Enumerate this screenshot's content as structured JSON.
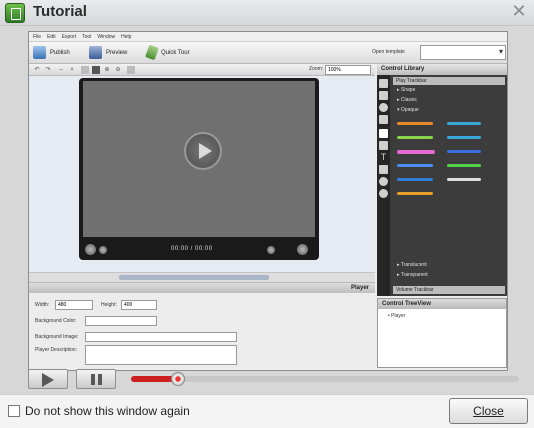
{
  "dialog": {
    "title": "Tutorial",
    "close_glyph": "✕",
    "dont_show_label": "Do not show this window again",
    "dont_show_checked": false,
    "close_label": "Close"
  },
  "app": {
    "menu": [
      "File",
      "Edit",
      "Export",
      "Tool",
      "Window",
      "Help"
    ],
    "toolbar": {
      "publish": "Publish",
      "preview": "Preview",
      "quick_tour": "Quick Tour",
      "open_template_label": "Open template",
      "open_template_value": ""
    },
    "zoom_label": "Zoom:",
    "zoom_value": "100%",
    "player_time": "00:00 / 00:00",
    "properties": {
      "header": "Player",
      "width_label": "Width:",
      "width_value": "480",
      "height_label": "Height:",
      "height_value": "400",
      "bg_color_label": "Background Color:",
      "bg_image_label": "Background Image:",
      "description_label": "Player Description:"
    },
    "control_library": {
      "header": "Control Library",
      "active_section": "Play Trackbar",
      "items": [
        "Shape",
        "Classic",
        "Opaque"
      ],
      "lower_items": [
        "Translucent",
        "Transparent"
      ],
      "bottom_section": "Volume Trackbar"
    },
    "treeview": {
      "header": "Control TreeView",
      "item": "Player"
    }
  },
  "video_controls": {
    "progress": 0.12
  },
  "colors": {
    "progress": "#cc1f1f",
    "library_bg": "#3c3c3c"
  }
}
